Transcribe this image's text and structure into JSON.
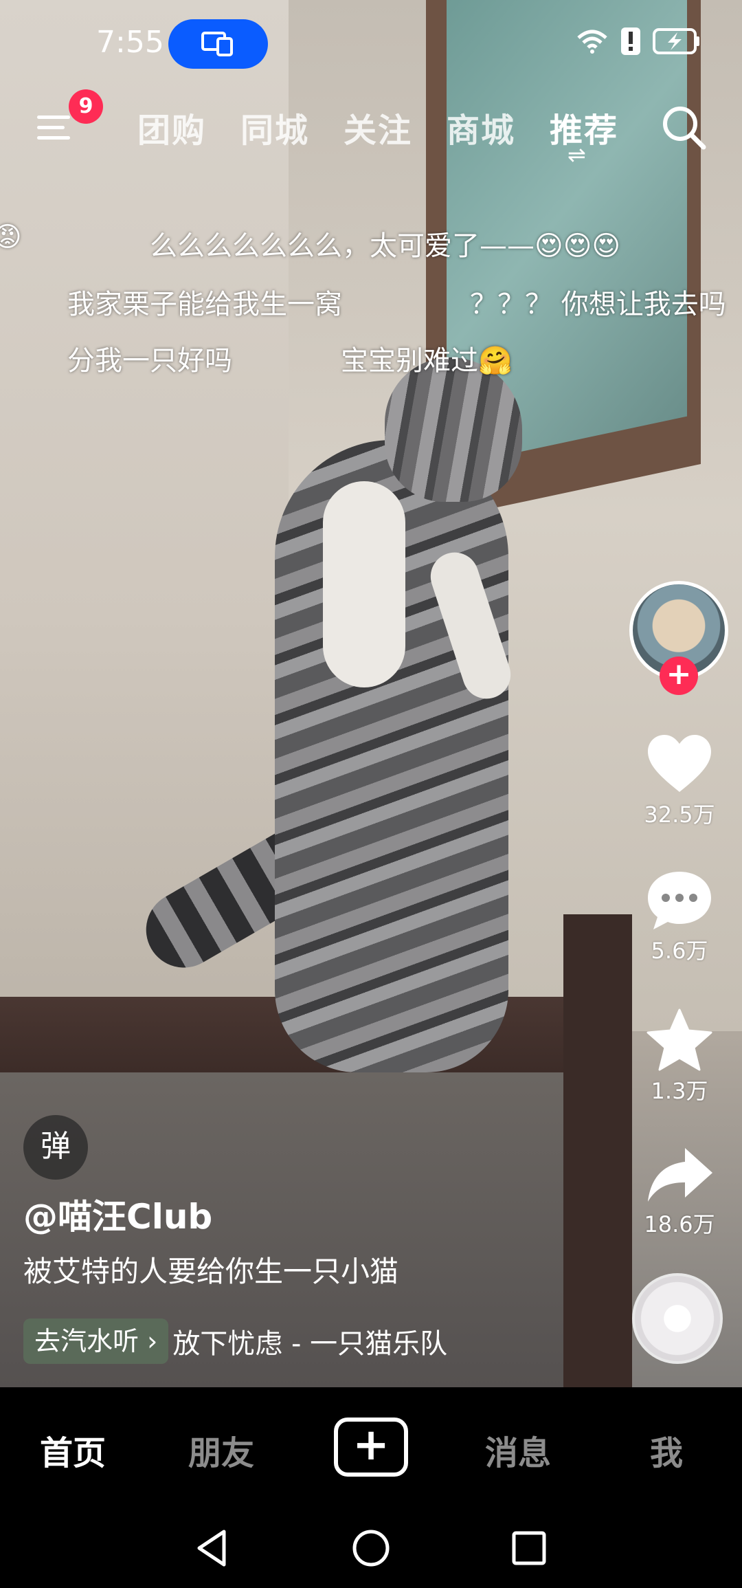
{
  "status_bar": {
    "time": "7:55",
    "icons": [
      "cast-icon",
      "wifi-icon",
      "alert-icon",
      "battery-charging-icon"
    ]
  },
  "top_nav": {
    "menu_badge": "9",
    "tabs": [
      "团购",
      "同城",
      "关注",
      "商城",
      "推荐"
    ],
    "active_tab": "推荐",
    "switch_glyph": "⇌"
  },
  "danmaku": [
    "么么么么么么么，太可爱了——😍😍😍",
    "我家栗子能给我生一窝",
    "？？？ 你想让我去吗",
    "分我一只好吗",
    "宝宝别难过🤗",
    "😡"
  ],
  "right_rail": {
    "follow_symbol": "+",
    "like_count": "32.5万",
    "comment_count": "5.6万",
    "favorite_count": "1.3万",
    "share_count": "18.6万"
  },
  "video_info": {
    "danmu_toggle": "弹",
    "author": "@喵汪Club",
    "caption": "被艾特的人要给你生一只小猫",
    "listen_button": "去汽水听",
    "listen_chevron": "›",
    "music_title": "放下忧虑 - 一只猫乐队"
  },
  "bottom_tabs": {
    "home": "首页",
    "friends": "朋友",
    "create": "+",
    "messages": "消息",
    "me": "我"
  },
  "colors": {
    "accent": "#fe2c55",
    "cast_pill": "#0a5cff",
    "tab_bar": "#000000"
  }
}
